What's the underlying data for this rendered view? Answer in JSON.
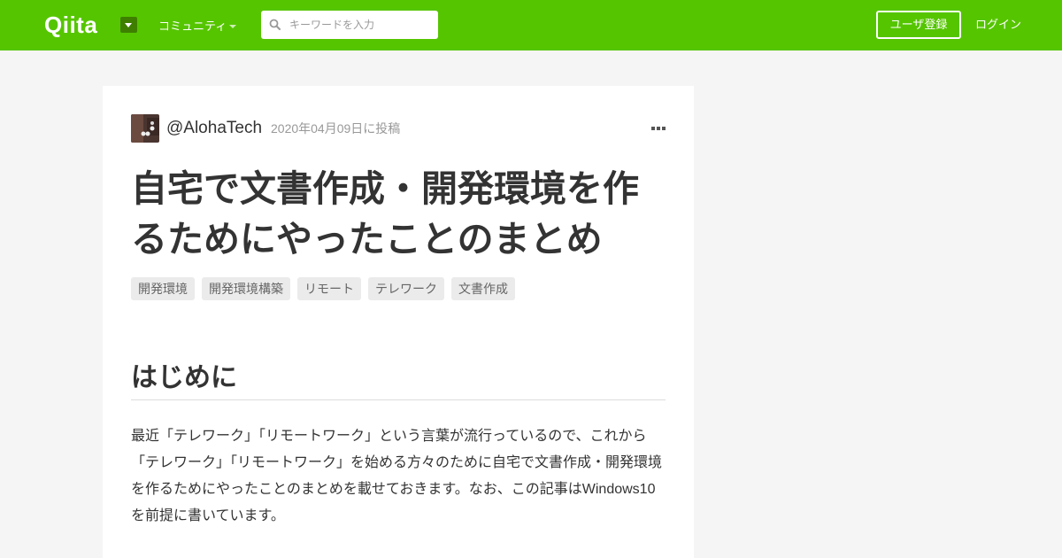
{
  "header": {
    "logo": "Qiita",
    "community_label": "コミュニティ",
    "search_placeholder": "キーワードを入力",
    "signup_label": "ユーザ登録",
    "login_label": "ログイン",
    "brand_color": "#55c500"
  },
  "article": {
    "author": "@AlohaTech",
    "posted_date": "2020年04月09日に投稿",
    "title": "自宅で文書作成・開発環境を作るためにやったことのまとめ",
    "tags": [
      "開発環境",
      "開発環境構築",
      "リモート",
      "テレワーク",
      "文書作成"
    ],
    "section_heading": "はじめに",
    "body": "最近「テレワーク」「リモートワーク」という言葉が流行っているので、これから「テレワーク」「リモートワーク」を始める方々のために自宅で文書作成・開発環境を作るためにやったことのまとめを載せておきます。なお、この記事はWindows10を前提に書いています。"
  }
}
